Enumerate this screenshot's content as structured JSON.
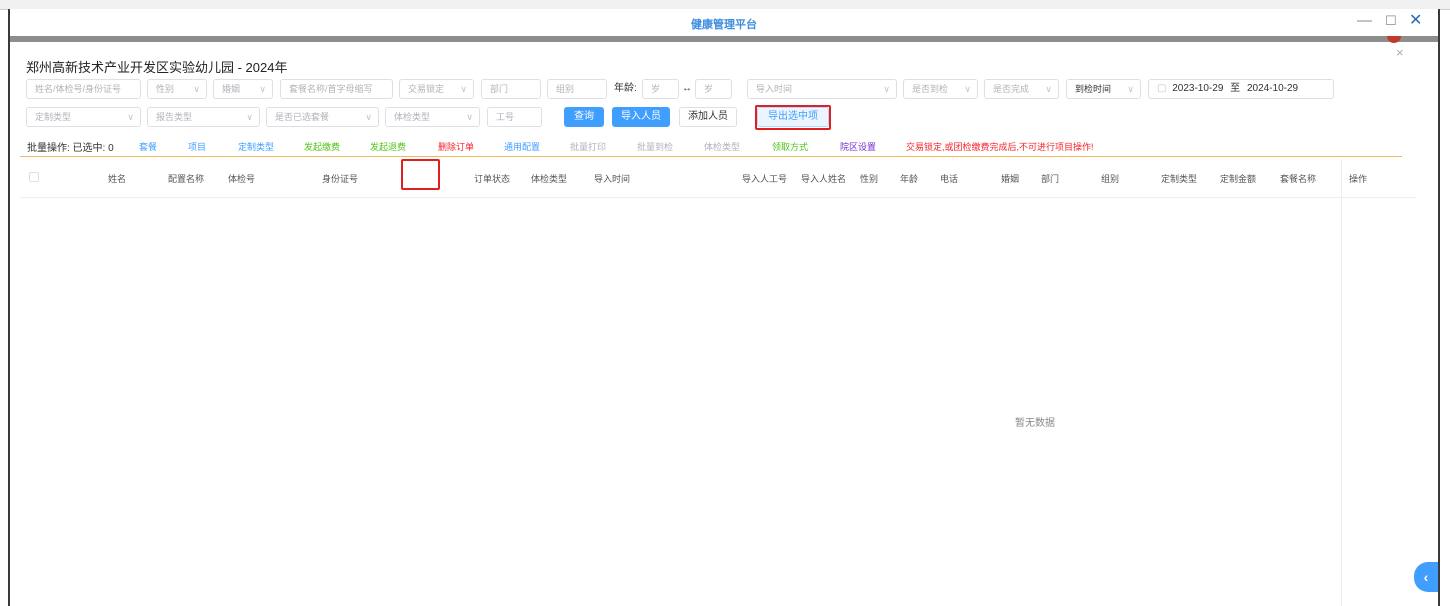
{
  "window": {
    "title": "健康管理平台",
    "minimize": "—",
    "maximize": "☐",
    "close": "✕"
  },
  "dialog": {
    "close": "×"
  },
  "org_title": "郑州高新技术产业开发区实验幼儿园 - 2024年",
  "filters": {
    "name_idcard": "姓名/体检号/身份证号",
    "gender": "性别",
    "marriage": "婚姻",
    "package": "套餐名称/首字母缩写",
    "trade_lock": "交易锁定",
    "department": "部门",
    "group": "组别",
    "age_label": "年龄:",
    "age_from": "岁",
    "age_sep": "↔",
    "age_to": "岁",
    "import_time": "导入时间",
    "arrived": "是否到检",
    "completed": "是否完成",
    "check_time": "到检时间",
    "date_start": "2023-10-29",
    "date_sep": "至",
    "date_end": "2024-10-29",
    "custom_type": "定制类型",
    "report_type": "报告类型",
    "package_selected": "是否已选套餐",
    "exam_type": "体检类型",
    "employee_no": "工号"
  },
  "buttons": {
    "query": "查询",
    "import": "导入人员",
    "add": "添加人员",
    "export_selected": "导出选中项"
  },
  "batch": {
    "label": "批量操作: 已选中: 0",
    "items": [
      {
        "text": "套餐",
        "color": "#409eff"
      },
      {
        "text": "项目",
        "color": "#409eff"
      },
      {
        "text": "定制类型",
        "color": "#409eff"
      },
      {
        "text": "发起缴费",
        "color": "#52c41a"
      },
      {
        "text": "发起退费",
        "color": "#52c41a"
      },
      {
        "text": "删除订单",
        "color": "#f5222d"
      },
      {
        "text": "通用配置",
        "color": "#409eff"
      },
      {
        "text": "批量打印",
        "color": "#b0b3b8"
      },
      {
        "text": "批量到检",
        "color": "#b0b3b8"
      },
      {
        "text": "体检类型",
        "color": "#b0b3b8"
      },
      {
        "text": "领取方式",
        "color": "#52c41a"
      },
      {
        "text": "院区设置",
        "color": "#722ed1"
      },
      {
        "text": "交易锁定,或团检缴费完成后,不可进行项目操作!",
        "color": "#f5222d"
      }
    ]
  },
  "table": {
    "columns": [
      "姓名",
      "配置名称",
      "体检号",
      "身份证号",
      "订单状态",
      "体检类型",
      "导入时间",
      "导入人工号",
      "导入人姓名",
      "性别",
      "年龄",
      "电话",
      "婚姻",
      "部门",
      "组别",
      "定制类型",
      "定制金额",
      "套餐名称",
      "操作"
    ],
    "empty": "暂无数据"
  },
  "side_tab": "‹",
  "colors": {
    "accent": "#409eff",
    "highlight": "#e02020"
  }
}
